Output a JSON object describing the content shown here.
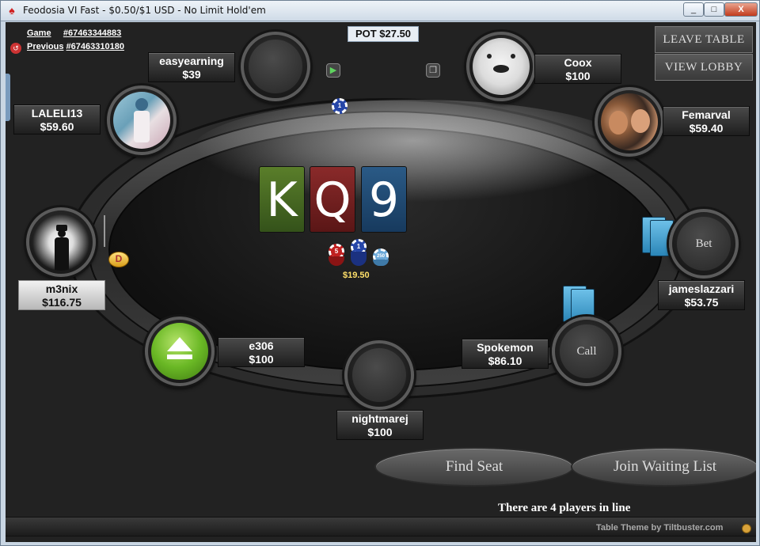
{
  "window": {
    "title": "Feodosia VI Fast - $0.50/$1 USD - No Limit Hold'em",
    "minimize": "_",
    "maximize": "□",
    "close": "X"
  },
  "game": {
    "game_label": "Game",
    "game_number": "#67463344883",
    "previous_label": "Previous",
    "previous_number": "#67463310180",
    "pot": "POT $27.50",
    "bet_amount": "$19.50"
  },
  "buttons": {
    "leave_table": "LEAVE TABLE",
    "view_lobby": "VIEW LOBBY",
    "find_seat": "Find Seat",
    "join_waiting_list": "Join Waiting List"
  },
  "board": {
    "cards": [
      "K",
      "Q",
      "9"
    ],
    "colors": [
      "#4a6e22",
      "#7a2222",
      "#224f78"
    ]
  },
  "seats": [
    {
      "name": "easyearning",
      "stack": "$39"
    },
    {
      "name": "Coox",
      "stack": "$100"
    },
    {
      "name": "LALELI13",
      "stack": "$59.60"
    },
    {
      "name": "Femarval",
      "stack": "$59.40"
    },
    {
      "name": "m3nix",
      "stack": "$116.75"
    },
    {
      "name": "jameslazzari",
      "stack": "$53.75",
      "action": "Bet"
    },
    {
      "name": "e306",
      "stack": "$100"
    },
    {
      "name": "Spokemon",
      "stack": "$86.10",
      "action": "Call"
    },
    {
      "name": "nightmarej",
      "stack": "$100"
    }
  ],
  "chips": {
    "pot_chip": "1",
    "chip_a": "5",
    "chip_b": "1",
    "chip_c": "250"
  },
  "dealer": "D",
  "waiting_info": "There are 4 players in line",
  "theme_credit": "Table Theme by Tiltbuster.com"
}
